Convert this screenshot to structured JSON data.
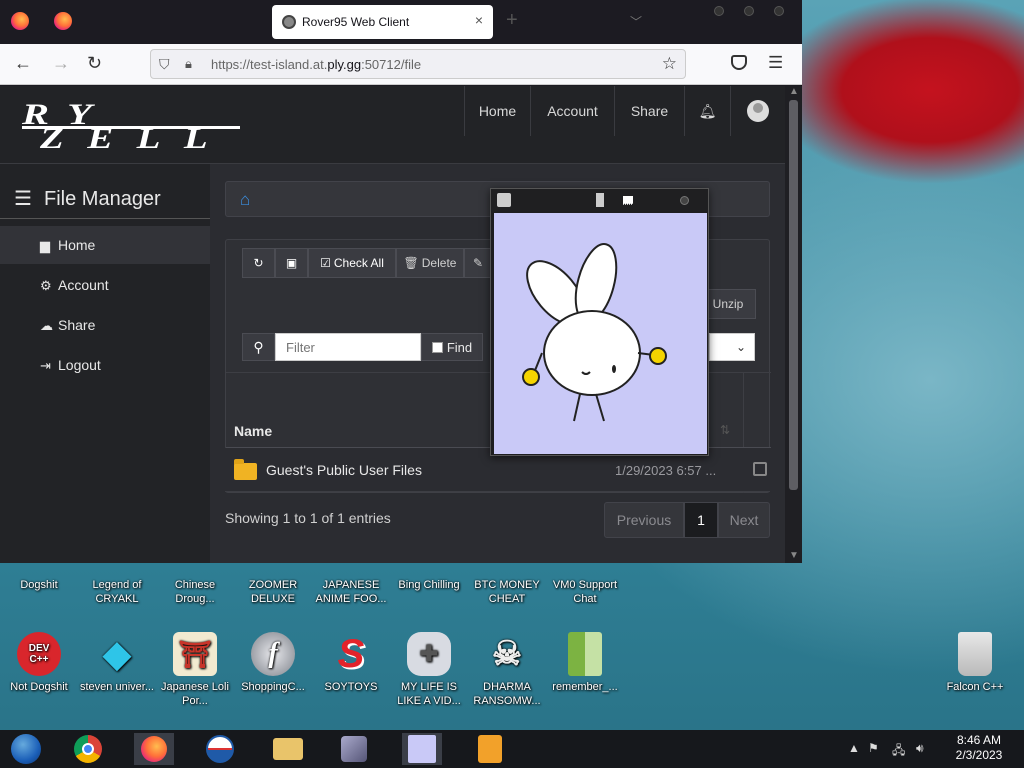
{
  "browser": {
    "tab_title": "Rover95 Web Client",
    "tab_close": "×",
    "new_tab": "+",
    "url_prefix": "https://test-island.at.",
    "url_domain": "ply.gg",
    "url_suffix": ":50712/file"
  },
  "site": {
    "logo_line1": "RY",
    "logo_line2": "ZELL",
    "nav": {
      "home": "Home",
      "account": "Account",
      "share": "Share"
    }
  },
  "sidebar": {
    "title": "File Manager",
    "items": [
      {
        "label": "Home",
        "icon": "folder-open-icon",
        "glyph": "▆"
      },
      {
        "label": "Account",
        "icon": "gear-icon",
        "glyph": "⚙"
      },
      {
        "label": "Share",
        "icon": "cloud-icon",
        "glyph": "☁"
      },
      {
        "label": "Logout",
        "icon": "logout-icon",
        "glyph": "⇥"
      }
    ]
  },
  "toolbar": {
    "check_all": "Check All",
    "delete": "Delete",
    "unzip": "Unzip",
    "filter_placeholder": "Filter",
    "find": "Find"
  },
  "table": {
    "col_name": "Name",
    "rows": [
      {
        "name": "Guest's Public User Files",
        "date": "1/29/2023 6:57 ..."
      }
    ]
  },
  "pagination": {
    "showing": "Showing 1 to 1 of 1 entries",
    "previous": "Previous",
    "current": "1",
    "next": "Next"
  },
  "desktop": {
    "row1": [
      {
        "label": "Dogshit"
      },
      {
        "label": "Legend of CRYAKL"
      },
      {
        "label": "Chinese Droug..."
      },
      {
        "label": "ZOOMER DELUXE"
      },
      {
        "label": "JAPANESE ANIME FOO..."
      },
      {
        "label": "Bing Chilling"
      },
      {
        "label": "BTC MONEY CHEAT"
      },
      {
        "label": "VM0 Support Chat"
      }
    ],
    "row2": [
      {
        "label": "Not Dogshit",
        "glyph": "DEV C++",
        "color": "#d9262c"
      },
      {
        "label": "steven univer...",
        "glyph": "◆",
        "color": "#2ec5e8"
      },
      {
        "label": "Japanese Loli Por...",
        "glyph": "⛩",
        "color": "#f0e6c8"
      },
      {
        "label": "ShoppingC...",
        "glyph": "f",
        "color": "#9aa0a8"
      },
      {
        "label": "SOYTOYS",
        "glyph": "S",
        "color": "#e3232a"
      },
      {
        "label": "MY LIFE IS LIKE A VID...",
        "glyph": "🎮",
        "color": "#cfd3da"
      },
      {
        "label": "DHARMA RANSOMW...",
        "glyph": "☠",
        "color": "#555"
      },
      {
        "label": "remember_...",
        "glyph": "▮",
        "color": "#8bc34a"
      }
    ],
    "recycle": {
      "label": "Falcon C++"
    }
  },
  "taskbar": {
    "time": "8:46 AM",
    "date": "2/3/2023"
  },
  "colors": {
    "accent_blue": "#3b8fe0",
    "folder": "#f0b323",
    "popup_bg": "#c9c9f7"
  }
}
